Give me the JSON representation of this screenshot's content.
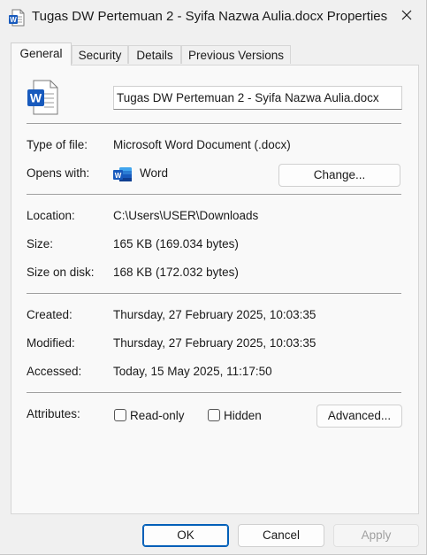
{
  "window": {
    "title": "Tugas DW Pertemuan 2 - Syifa Nazwa Aulia.docx Properties",
    "icon": "word-doc-icon",
    "close_icon": "close-icon"
  },
  "tabs": [
    {
      "label": "General",
      "active": true
    },
    {
      "label": "Security",
      "active": false
    },
    {
      "label": "Details",
      "active": false
    },
    {
      "label": "Previous Versions",
      "active": false
    }
  ],
  "general": {
    "file_name": "Tugas DW Pertemuan 2 - Syifa Nazwa Aulia.docx",
    "type_label": "Type of file:",
    "type_value": "Microsoft Word Document (.docx)",
    "opens_label": "Opens with:",
    "opens_value": "Word",
    "change_button": "Change...",
    "location_label": "Location:",
    "location_value": "C:\\Users\\USER\\Downloads",
    "size_label": "Size:",
    "size_value": "165 KB (169.034 bytes)",
    "size_disk_label": "Size on disk:",
    "size_disk_value": "168 KB (172.032 bytes)",
    "created_label": "Created:",
    "created_value": "Thursday, 27 February 2025, 10:03:35",
    "modified_label": "Modified:",
    "modified_value": "Thursday, 27 February 2025, 10:03:35",
    "accessed_label": "Accessed:",
    "accessed_value": "Today, 15 May 2025, 11:17:50",
    "attributes_label": "Attributes:",
    "readonly_label": "Read-only",
    "readonly_checked": false,
    "hidden_label": "Hidden",
    "hidden_checked": false,
    "advanced_button": "Advanced..."
  },
  "footer": {
    "ok": "OK",
    "cancel": "Cancel",
    "apply": "Apply"
  },
  "colors": {
    "word_blue": "#185abd",
    "accent": "#005fb8"
  }
}
